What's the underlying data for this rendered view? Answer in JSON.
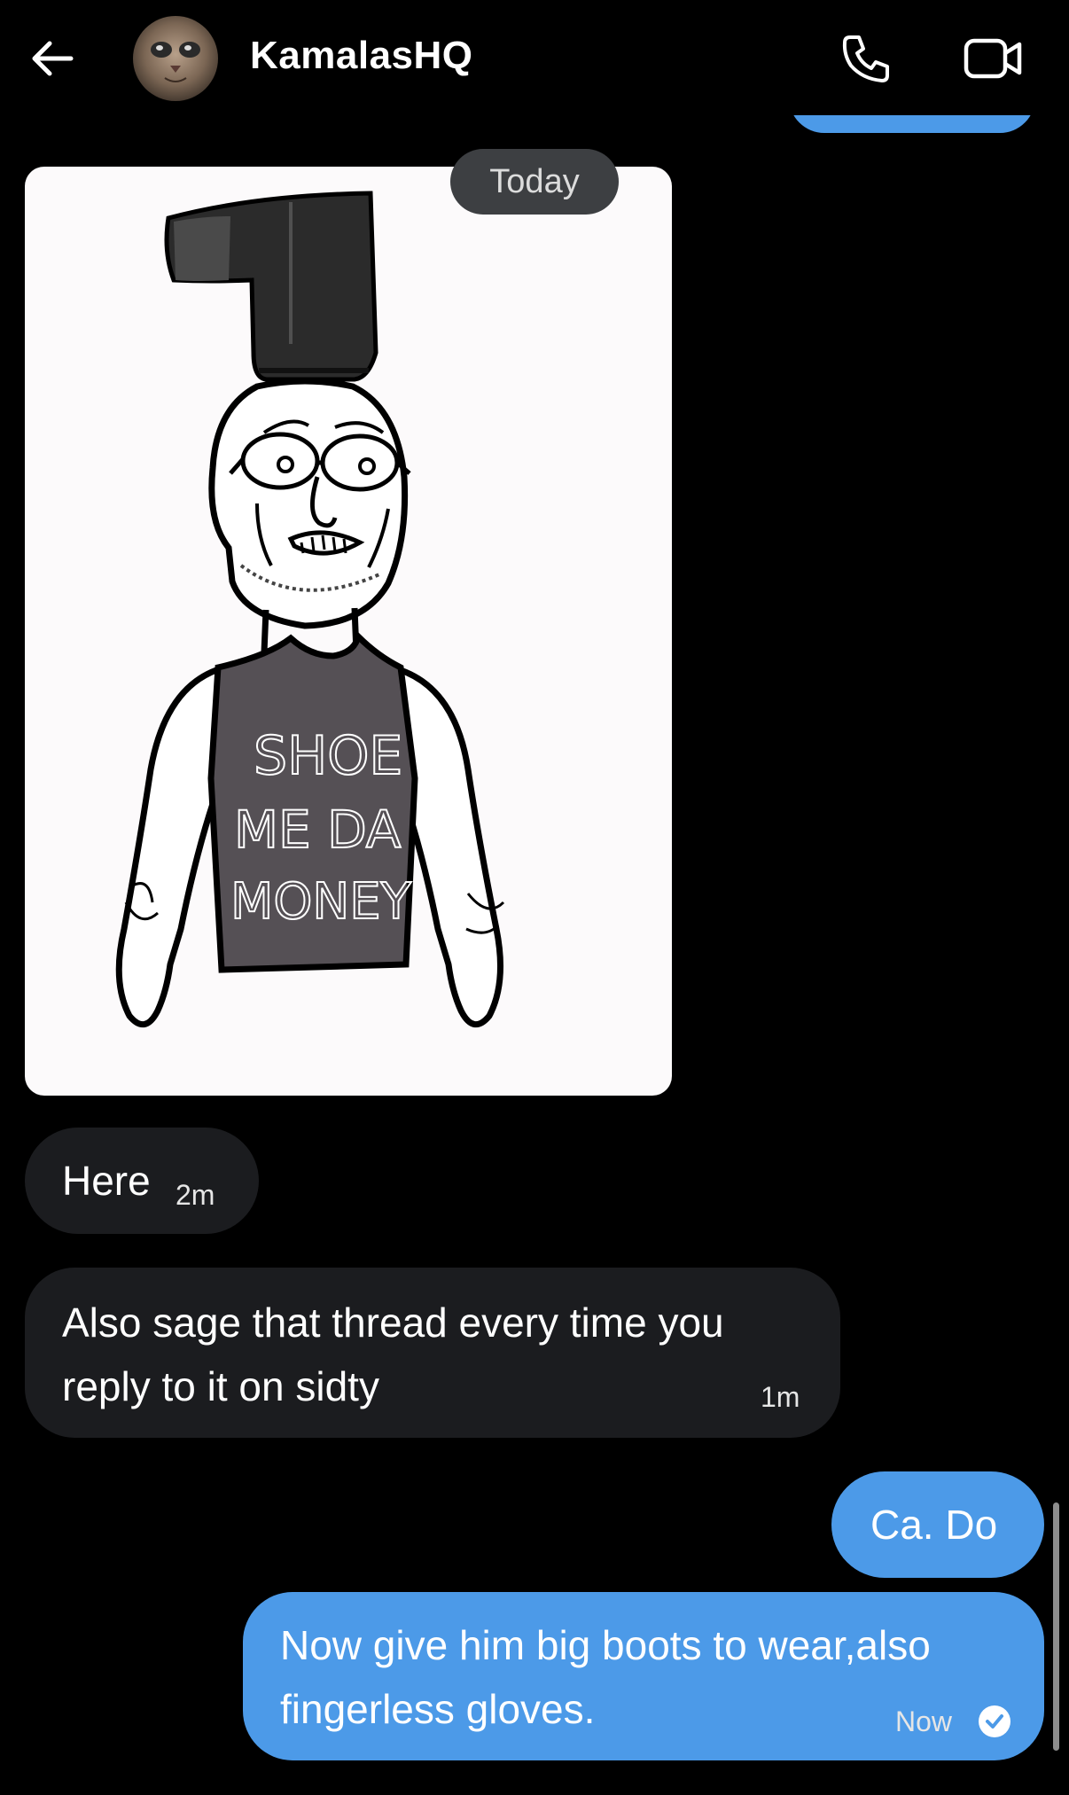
{
  "header": {
    "contact_name": "KamalasHQ",
    "back_icon": "arrow-left-icon",
    "call_icon": "phone-icon",
    "video_icon": "video-camera-icon"
  },
  "date_separator": "Today",
  "image_message": {
    "shirt_text_lines": [
      "SHOE",
      "ME DA",
      "MONEY"
    ]
  },
  "messages": [
    {
      "direction": "incoming",
      "text": "Here",
      "time": "2m"
    },
    {
      "direction": "incoming",
      "text": "Also sage that thread every time you\nreply to it on sidty",
      "time": "1m"
    },
    {
      "direction": "outgoing",
      "text": "Ca. Do",
      "time": ""
    },
    {
      "direction": "outgoing",
      "text": "Now give him big boots to wear,also\nfingerless gloves.",
      "time": "Now",
      "status": "read"
    }
  ],
  "colors": {
    "background": "#000000",
    "incoming_bubble": "#1b1c1f",
    "outgoing_bubble": "#4c9ae8",
    "date_pill": "#3d3f42"
  }
}
